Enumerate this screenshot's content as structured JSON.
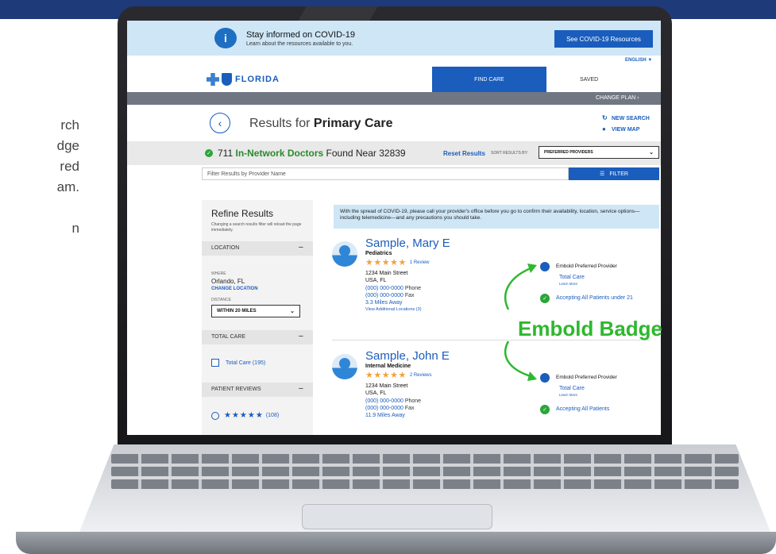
{
  "left_copy": {
    "lines": [
      "rch",
      "dge",
      "red",
      "am.",
      "",
      "n"
    ]
  },
  "covid_banner": {
    "title": "Stay informed on COVID-19",
    "subtitle": "Learn about the resources available to you.",
    "button": "See COVID-19 Resources",
    "icon": "info-heart-icon"
  },
  "lang": {
    "label": "ENGLISH ▼"
  },
  "nav": {
    "logo_text": "FLORIDA",
    "find_care": "FIND CARE",
    "saved": "SAVED",
    "change_plan": "CHANGE PLAN ›"
  },
  "results": {
    "prefix": "Results for",
    "subject": "Primary Care",
    "new_search": "NEW SEARCH",
    "view_map": "VIEW MAP"
  },
  "found": {
    "count": "711",
    "network": "In-Network Doctors",
    "suffix": "Found Near 32839",
    "reset": "Reset Results",
    "sort_label": "SORT RESULTS BY:",
    "sort_value": "PREFERRED PROVIDERS"
  },
  "filter": {
    "placeholder": "Filter Results by Provider Name",
    "button": "FILTER"
  },
  "sidebar": {
    "title": "Refine Results",
    "subtitle": "Changing a search results filter will reload the page immediately.",
    "location_head": "LOCATION",
    "where_label": "WHERE",
    "where_value": "Orlando, FL",
    "change_location": "CHANGE LOCATION",
    "distance_label": "DISTANCE",
    "distance_value": "WITHIN 20 MILES",
    "total_care_head": "TOTAL CARE",
    "total_care_option": "Total Care (195)",
    "reviews_head": "PATIENT REVIEWS",
    "reviews_option_count": "(108)",
    "minus": "−"
  },
  "notice": "With the spread of COVID-19, please call your provider's office before you go to confirm their availability, location, service options—including telemedicine—and any precautions you should take.",
  "providers": [
    {
      "name": "Sample, Mary E",
      "specialty": "Pediatrics",
      "stars": "★★★★★",
      "reviews": "1 Review",
      "street": "1234 Main Street",
      "city": "USA, FL",
      "phone": "(000) 000-0000",
      "phone_label": "Phone",
      "fax": "(000) 000-0000",
      "fax_label": "Fax",
      "distance": "3.3 Miles Away",
      "extra": "View Additional Locations (3)",
      "badge": "Embold Preferred Provider",
      "total_care": "Total Care",
      "learn_more": "Learn More",
      "accepting": "Accepting All Patients under 21"
    },
    {
      "name": "Sample, John E",
      "specialty": "Internal Medicine",
      "stars": "★★★★★",
      "reviews": "2 Reviews",
      "street": "1234 Main Street",
      "city": "USA, FL",
      "phone": "(000) 000-0000",
      "phone_label": "Phone",
      "fax": "(000) 000-0000",
      "fax_label": "Fax",
      "distance": "11.9 Miles Away",
      "badge": "Embold Preferred Provider",
      "total_care": "Total Care",
      "learn_more": "Learn More",
      "accepting": "Accepting All Patients"
    }
  ],
  "callout": "Embold Badge",
  "colors": {
    "brand_blue": "#1a5dbc",
    "callout_green": "#2eb82e",
    "accept_green": "#2aa53a"
  }
}
